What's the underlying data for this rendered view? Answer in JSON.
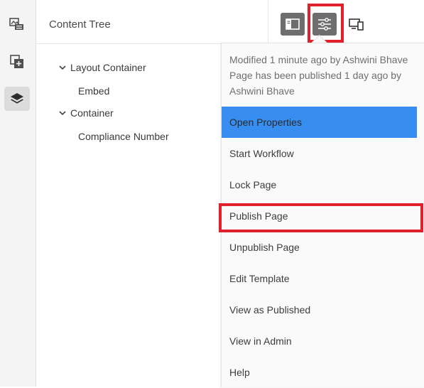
{
  "panel": {
    "title": "Content Tree"
  },
  "tree": [
    {
      "label": "Layout Container",
      "expanded": true,
      "level": 0
    },
    {
      "label": "Embed",
      "level": 1
    },
    {
      "label": "Container",
      "expanded": true,
      "level": 0
    },
    {
      "label": "Compliance Number",
      "level": 1
    }
  ],
  "rail": {
    "icons": [
      "assets-icon",
      "components-icon",
      "layers-icon"
    ],
    "active": "layers-icon"
  },
  "toolbar": {
    "icons": [
      "side-panel-toggle-icon",
      "page-information-icon",
      "emulator-icon"
    ],
    "highlighted": "page-information-icon"
  },
  "page_info": {
    "meta_line1": "Modified 1 minute ago by Ashwini Bhave",
    "meta_line2": "Page has been published 1 day ago by",
    "meta_line3": "Ashwini Bhave",
    "menu": [
      {
        "label": "Open Properties",
        "selected": true
      },
      {
        "label": "Start Workflow"
      },
      {
        "label": "Lock Page"
      },
      {
        "label": "Publish Page",
        "highlighted": true
      },
      {
        "label": "Unpublish Page"
      },
      {
        "label": "Edit Template"
      },
      {
        "label": "View as Published"
      },
      {
        "label": "View in Admin"
      },
      {
        "label": "Help"
      }
    ]
  },
  "colors": {
    "selection": "#378ef0",
    "highlight_box": "#e0202a",
    "toolbar_button": "#6e6e6e"
  }
}
